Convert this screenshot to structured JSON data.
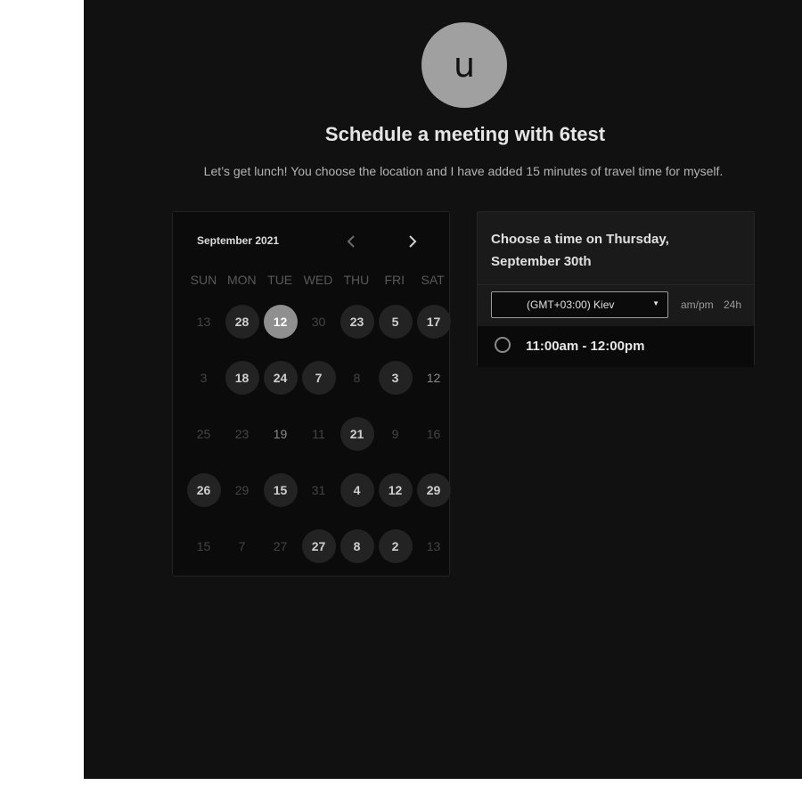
{
  "host": {
    "avatar_initial": "u",
    "title": "Schedule a meeting with 6test",
    "description": "Let’s get lunch! You choose the location and I have added 15 minutes of travel time for myself."
  },
  "calendar": {
    "month_label": "September 2021",
    "prev_icon": "chevron-left-icon",
    "next_icon": "chevron-right-icon",
    "weekdays": [
      "SUN",
      "MON",
      "TUE",
      "WED",
      "THU",
      "FRI",
      "SAT"
    ],
    "weeks": [
      [
        {
          "label": "13",
          "state": "unavailable"
        },
        {
          "label": "28",
          "state": "available"
        },
        {
          "label": "12",
          "state": "selected"
        },
        {
          "label": "30",
          "state": "unavailable"
        },
        {
          "label": "23",
          "state": "available"
        },
        {
          "label": "5",
          "state": "available"
        },
        {
          "label": "17",
          "state": "available"
        }
      ],
      [
        {
          "label": "3",
          "state": "unavailable"
        },
        {
          "label": "18",
          "state": "available"
        },
        {
          "label": "24",
          "state": "available"
        },
        {
          "label": "7",
          "state": "available"
        },
        {
          "label": "8",
          "state": "unavailable"
        },
        {
          "label": "3",
          "state": "available"
        },
        {
          "label": "12",
          "state": "dim"
        }
      ],
      [
        {
          "label": "25",
          "state": "unavailable"
        },
        {
          "label": "23",
          "state": "unavailable"
        },
        {
          "label": "19",
          "state": "dim"
        },
        {
          "label": "11",
          "state": "unavailable"
        },
        {
          "label": "21",
          "state": "available"
        },
        {
          "label": "9",
          "state": "unavailable"
        },
        {
          "label": "16",
          "state": "unavailable"
        }
      ],
      [
        {
          "label": "26",
          "state": "available"
        },
        {
          "label": "29",
          "state": "unavailable"
        },
        {
          "label": "15",
          "state": "available"
        },
        {
          "label": "31",
          "state": "unavailable"
        },
        {
          "label": "4",
          "state": "available"
        },
        {
          "label": "12",
          "state": "available"
        },
        {
          "label": "29",
          "state": "available"
        }
      ],
      [
        {
          "label": "15",
          "state": "unavailable"
        },
        {
          "label": "7",
          "state": "unavailable"
        },
        {
          "label": "27",
          "state": "unavailable"
        },
        {
          "label": "27",
          "state": "available"
        },
        {
          "label": "8",
          "state": "available"
        },
        {
          "label": "2",
          "state": "available"
        },
        {
          "label": "13",
          "state": "unavailable"
        }
      ]
    ]
  },
  "times": {
    "heading": "Choose a time on Thursday, September 30th",
    "timezone_value": "(GMT+03:00) Kiev",
    "format_ampm": "am/pm",
    "format_24h": "24h",
    "slots": [
      {
        "label": "11:00am - 12:00pm",
        "selected": false
      }
    ]
  },
  "colors": {
    "background": "#111111",
    "card": "#1a1a1a",
    "avatar": "#a0a0a0",
    "selected_day": "#8f8f8f"
  }
}
